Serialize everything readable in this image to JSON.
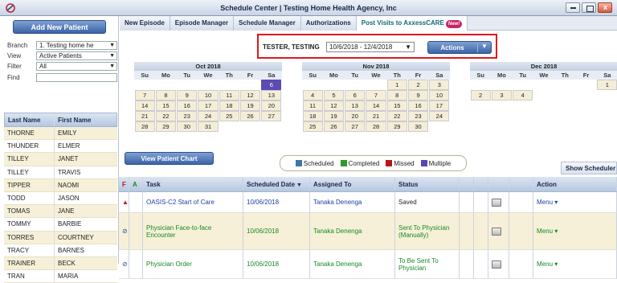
{
  "window": {
    "title": "Schedule Center | Testing Home Health Agency, Inc"
  },
  "sidebar": {
    "add_button": "Add New Patient",
    "filters": [
      {
        "label": "Branch",
        "value": "1. Testing home he",
        "type": "select"
      },
      {
        "label": "View",
        "value": "Active Patients",
        "type": "select"
      },
      {
        "label": "Filter",
        "value": "All",
        "type": "select"
      },
      {
        "label": "Find",
        "value": "",
        "type": "input"
      }
    ],
    "columns": [
      "Last Name",
      "First Name"
    ],
    "patients": [
      [
        "THORNE",
        "EMILY"
      ],
      [
        "THUNDER",
        "ELMER"
      ],
      [
        "TILLEY",
        "JANET"
      ],
      [
        "TILLEY",
        "TRAVIS"
      ],
      [
        "TIPPER",
        "NAOMI"
      ],
      [
        "TODD",
        "JASON"
      ],
      [
        "TOMAS",
        "JANE"
      ],
      [
        "TOMMY",
        "BARBIE"
      ],
      [
        "TORRES",
        "COURTNEY"
      ],
      [
        "TRACY",
        "BARNES"
      ],
      [
        "TRAINER",
        "BECK"
      ],
      [
        "TRAN",
        "MARIA"
      ]
    ]
  },
  "tabs": [
    {
      "label": "New Episode"
    },
    {
      "label": "Episode Manager"
    },
    {
      "label": "Schedule Manager"
    },
    {
      "label": "Authorizations"
    },
    {
      "label": "Post Visits to AxxessCARE",
      "badge": "New!"
    }
  ],
  "episode": {
    "patient_name": "TESTER, TESTING",
    "date_range": "10/6/2018 - 12/4/2018",
    "actions_label": "Actions"
  },
  "calendar": {
    "weekdays": [
      "Su",
      "Mo",
      "Tu",
      "We",
      "Th",
      "Fr",
      "Sa"
    ],
    "months": [
      {
        "name": "Oct 2018",
        "weeks": [
          [
            "",
            "",
            "",
            "",
            "",
            "",
            "6"
          ],
          [
            "7",
            "8",
            "9",
            "10",
            "11",
            "12",
            "13"
          ],
          [
            "14",
            "15",
            "16",
            "17",
            "18",
            "19",
            "20"
          ],
          [
            "21",
            "22",
            "23",
            "24",
            "25",
            "26",
            "27"
          ],
          [
            "28",
            "29",
            "30",
            "31",
            "",
            "",
            ""
          ]
        ],
        "selected_day": "6"
      },
      {
        "name": "Nov 2018",
        "weeks": [
          [
            "",
            "",
            "",
            "",
            "1",
            "2",
            "3"
          ],
          [
            "4",
            "5",
            "6",
            "7",
            "8",
            "9",
            "10"
          ],
          [
            "11",
            "12",
            "13",
            "14",
            "15",
            "16",
            "17"
          ],
          [
            "18",
            "19",
            "20",
            "21",
            "22",
            "23",
            "24"
          ],
          [
            "25",
            "26",
            "27",
            "28",
            "29",
            "30",
            ""
          ]
        ]
      },
      {
        "name": "Dec 2018",
        "weeks": [
          [
            "",
            "",
            "",
            "",
            "",
            "",
            "1"
          ],
          [
            "2",
            "3",
            "4",
            "",
            "",
            "",
            ""
          ]
        ]
      }
    ]
  },
  "view_chart_button": "View Patient Chart",
  "legend": [
    {
      "label": "Scheduled",
      "color": "#3b78a8"
    },
    {
      "label": "Completed",
      "color": "#2e9b2e"
    },
    {
      "label": "Missed",
      "color": "#b8161b"
    },
    {
      "label": "Multiple",
      "color": "#5a43b5"
    }
  ],
  "show_scheduler": "Show Scheduler",
  "task_table": {
    "columns": [
      "F",
      "A",
      "Task",
      "Scheduled Date",
      "Assigned To",
      "Status",
      "Action"
    ],
    "rows": [
      {
        "icon": "warning-icon",
        "icon_glyph": "▲",
        "task": "OASIS-C2 Start of Care",
        "date": "10/06/2018",
        "assigned": "Tanaka Denenga",
        "status": "Saved",
        "status_color": "#222",
        "color": "#1d3fa3",
        "action": "Menu"
      },
      {
        "icon": "no-entry-icon",
        "icon_glyph": "⊘",
        "task": "Physician Face-to-face Encounter",
        "date": "10/06/2018",
        "assigned": "Tanaka Denenga",
        "status": "Sent To Physician (Manually)",
        "status_color": "#178a24",
        "color": "#178a24",
        "action": "Menu"
      },
      {
        "icon": "no-entry-icon",
        "icon_glyph": "⊘",
        "task": "Physician Order",
        "date": "10/06/2018",
        "assigned": "Tanaka Denenga",
        "status": "To Be Sent To Physician",
        "status_color": "#178a24",
        "color": "#178a24",
        "action": "Menu"
      }
    ]
  }
}
